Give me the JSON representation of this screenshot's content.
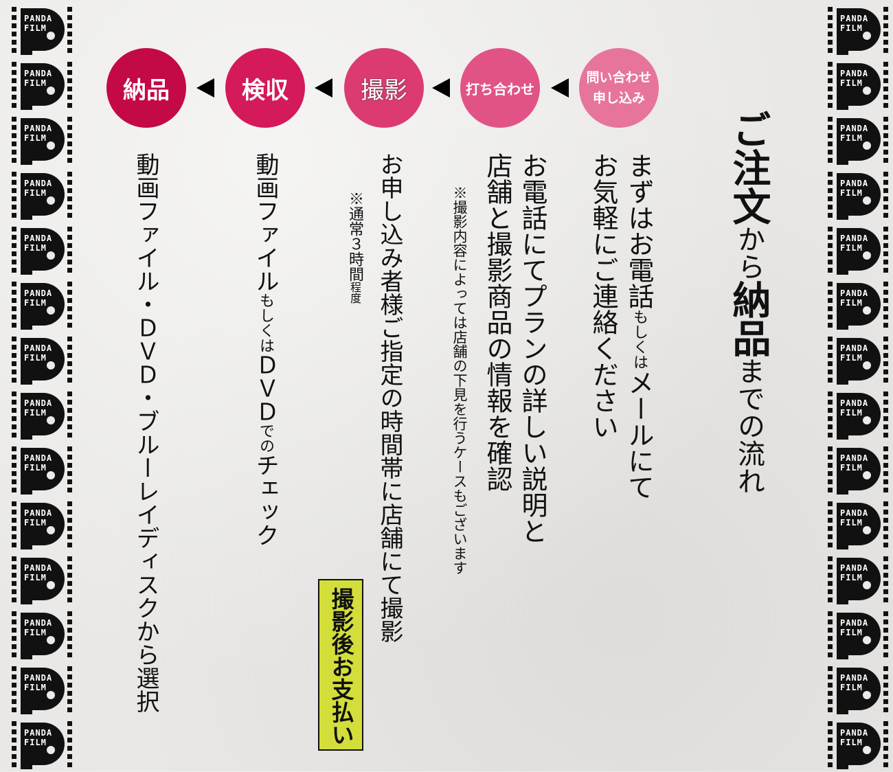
{
  "brand": {
    "line1": "PANDA",
    "line2": "FILM"
  },
  "title": {
    "part1": "ご注文",
    "part2": "から",
    "part3": "納品",
    "part4": "までの流れ"
  },
  "steps": [
    {
      "lines": [
        "問い合わせ",
        "申し込み"
      ],
      "color": "#e7749b"
    },
    {
      "lines": [
        "打ち合わせ"
      ],
      "color": "#e15387"
    },
    {
      "lines": [
        "撮影"
      ],
      "color": "#dc3b72"
    },
    {
      "lines": [
        "検収"
      ],
      "color": "#d41a5b"
    },
    {
      "lines": [
        "納品"
      ],
      "color": "#c40947"
    }
  ],
  "columns": {
    "inquiry_1a": "まずはお電話",
    "inquiry_1b": "もしくは",
    "inquiry_1c": "メールにて",
    "inquiry_2": "お気軽にご連絡ください",
    "meeting_1": "お電話にてプランの詳しい説明と",
    "meeting_2": "店舗と撮影商品の情報を確認",
    "meeting_note": "※撮影内容によっては店舗の下見を行うケースもございます",
    "shoot_1": "お申し込み者様ご指定の時間帯に店舗にて撮影",
    "shoot_note_a": "※通常３時間",
    "shoot_note_b": "程度",
    "payment_label": "撮影後お支払い",
    "inspection_a": "動画ファイル",
    "inspection_b": "もしくは",
    "inspection_c": "ＤＶＤ",
    "inspection_d": "での",
    "inspection_e": "チェック",
    "delivery": "動画ファイル・ＤＶＤ・ブルーレイディスクから選択"
  }
}
